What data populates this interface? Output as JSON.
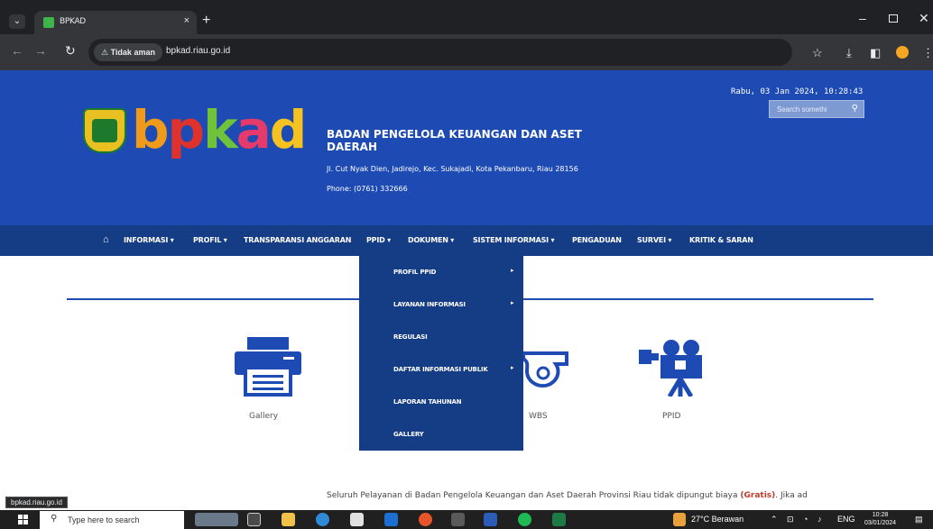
{
  "browser": {
    "tab_title": "BPKAD",
    "tab_close": "×",
    "new_tab": "+",
    "security_label": "Tidak aman",
    "url": "bpkad.riau.go.id",
    "status_url": "bpkad.riau.go.id"
  },
  "site": {
    "logo_word": [
      "b",
      "p",
      "k",
      "a",
      "d"
    ],
    "org_title": "BADAN PENGELOLA KEUANGAN DAN ASET DAERAH",
    "address": "Jl. Cut Nyak Dien, Jadirejo, Kec. Sukajadi, Kota Pekanbaru, Riau 28156",
    "phone": "Phone: (0761) 332666",
    "datetime": "Rabu, 03 Jan 2024, 10:28:43",
    "search_placeholder": "Search somethi"
  },
  "nav": {
    "items": [
      {
        "label": "INFORMASI ▾"
      },
      {
        "label": "PROFIL ▾"
      },
      {
        "label": "TRANSPARANSI ANGGARAN"
      },
      {
        "label": "PPID ▾"
      },
      {
        "label": "DOKUMEN ▾"
      },
      {
        "label": "SISTEM INFORMASI ▾"
      },
      {
        "label": "PENGADUAN"
      },
      {
        "label": "SURVEI ▾"
      },
      {
        "label": "KRITIK & SARAN"
      }
    ]
  },
  "dropdown": {
    "items": [
      {
        "label": "PROFIL PPID",
        "arrow": "▸"
      },
      {
        "label": "LAYANAN INFORMASI",
        "arrow": "▸"
      },
      {
        "label": "REGULASI",
        "arrow": ""
      },
      {
        "label": "DAFTAR INFORMASI PUBLIK",
        "arrow": "▸"
      },
      {
        "label": "LAPORAN TAHUNAN",
        "arrow": ""
      },
      {
        "label": "GALLERY",
        "arrow": ""
      }
    ]
  },
  "services": {
    "gallery": "Gallery",
    "wbs": "WBS",
    "ppid": "PPID"
  },
  "notice": {
    "text": "Seluruh Pelayanan di Badan Pengelola Keuangan dan Aset Daerah Provinsi Riau tidak dipungut biaya ",
    "highlight": "(Gratis)",
    "tail": ". Jika ad"
  },
  "taskbar": {
    "search_placeholder": "Type here to search",
    "weather": "27°C  Berawan",
    "lang": "ENG",
    "time": "10:28",
    "date": "03/01/2024"
  },
  "colors": {
    "header_blue": "#1e4bb3",
    "nav_blue": "#153d86",
    "highlight_red": "#c0392b"
  }
}
